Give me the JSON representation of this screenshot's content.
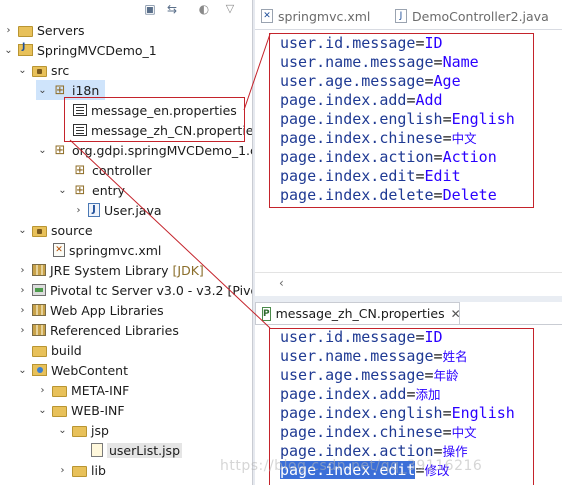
{
  "explorer": {
    "toolbar_icons": [
      "collapse-all-icon",
      "link-with-editor-icon",
      "focus-icon",
      "view-menu-icon"
    ],
    "items": [
      {
        "label": "Servers",
        "icon": "folder",
        "twisty": "›"
      },
      {
        "label": "SpringMVCDemo_1",
        "icon": "project",
        "twisty": "⌄"
      },
      {
        "label": "src",
        "icon": "srcfolder",
        "twisty": "⌄"
      },
      {
        "label": "i18n",
        "icon": "package",
        "twisty": "⌄"
      },
      {
        "label": "message_en.properties",
        "icon": "properties-file",
        "twisty": ""
      },
      {
        "label": "message_zh_CN.propertie",
        "icon": "properties-file",
        "twisty": ""
      },
      {
        "label": "org.gdpi.springMVCDemo_1.c",
        "icon": "package",
        "twisty": "⌄"
      },
      {
        "label": "controller",
        "icon": "package",
        "twisty": ""
      },
      {
        "label": "entry",
        "icon": "package",
        "twisty": "⌄"
      },
      {
        "label": "User.java",
        "icon": "java-file",
        "twisty": "›"
      },
      {
        "label": "source",
        "icon": "srcfolder",
        "twisty": "⌄"
      },
      {
        "label": "springmvc.xml",
        "icon": "xml-file",
        "twisty": ""
      },
      {
        "label": "JRE System Library",
        "suffix": "[JDK]",
        "icon": "library",
        "twisty": "›"
      },
      {
        "label": "Pivotal tc Server v3.0 - v3.2 [Pivot",
        "icon": "server-library",
        "twisty": "›"
      },
      {
        "label": "Web App Libraries",
        "icon": "library",
        "twisty": "›"
      },
      {
        "label": "Referenced Libraries",
        "icon": "library",
        "twisty": "›"
      },
      {
        "label": "build",
        "icon": "folder",
        "twisty": ""
      },
      {
        "label": "WebContent",
        "icon": "webcontent-folder",
        "twisty": "⌄"
      },
      {
        "label": "META-INF",
        "icon": "folder",
        "twisty": "›"
      },
      {
        "label": "WEB-INF",
        "icon": "folder",
        "twisty": "⌄"
      },
      {
        "label": "jsp",
        "icon": "folder",
        "twisty": "⌄"
      },
      {
        "label": "userList.jsp",
        "icon": "jsp-file",
        "twisty": ""
      },
      {
        "label": "lib",
        "icon": "folder",
        "twisty": "›"
      }
    ]
  },
  "editor_top": {
    "tabs": [
      {
        "label": "springmvc.xml",
        "icon": "xml-file-icon"
      },
      {
        "label": "DemoController2.java",
        "icon": "java-file-icon"
      }
    ],
    "lines": [
      {
        "key": "user.id.message",
        "eq": "=",
        "value": "ID"
      },
      {
        "key": "user.name.message",
        "eq": "=",
        "value": "Name"
      },
      {
        "key": "user.age.message",
        "eq": "=",
        "value": "Age"
      },
      {
        "key": "page.index.add",
        "eq": "=",
        "value": "Add"
      },
      {
        "key": "page.index.english",
        "eq": "=",
        "value": "English"
      },
      {
        "key": "page.index.chinese",
        "eq": "=",
        "value": "中文"
      },
      {
        "key": "page.index.action",
        "eq": "=",
        "value": "Action"
      },
      {
        "key": "page.index.edit",
        "eq": "=",
        "value": "Edit"
      },
      {
        "key": "page.index.delete",
        "eq": "=",
        "value": "Delete"
      }
    ],
    "scroll_left": "‹"
  },
  "editor_bottom": {
    "tab_label": "message_zh_CN.properties",
    "close": "✕",
    "lines": [
      {
        "key": "user.id.message",
        "eq": "=",
        "value": "ID"
      },
      {
        "key": "user.name.message",
        "eq": "=",
        "value": "姓名"
      },
      {
        "key": "user.age.message",
        "eq": "=",
        "value": "年龄"
      },
      {
        "key": "page.index.add",
        "eq": "=",
        "value": "添加"
      },
      {
        "key": "page.index.english",
        "eq": "=",
        "value": "English"
      },
      {
        "key": "page.index.chinese",
        "eq": "=",
        "value": "中文"
      },
      {
        "key": "page.index.action",
        "eq": "=",
        "value": "操作"
      },
      {
        "key": "page.index.edit",
        "eq": "=",
        "value": "修改"
      }
    ]
  },
  "watermark": "https://blog.csdn.net/qq_39116216",
  "colors": {
    "annotation_red": "#c4232b",
    "key_blue": "#1f3a93",
    "value_blue": "#2a00ff",
    "selection": "#3b6fd8"
  }
}
